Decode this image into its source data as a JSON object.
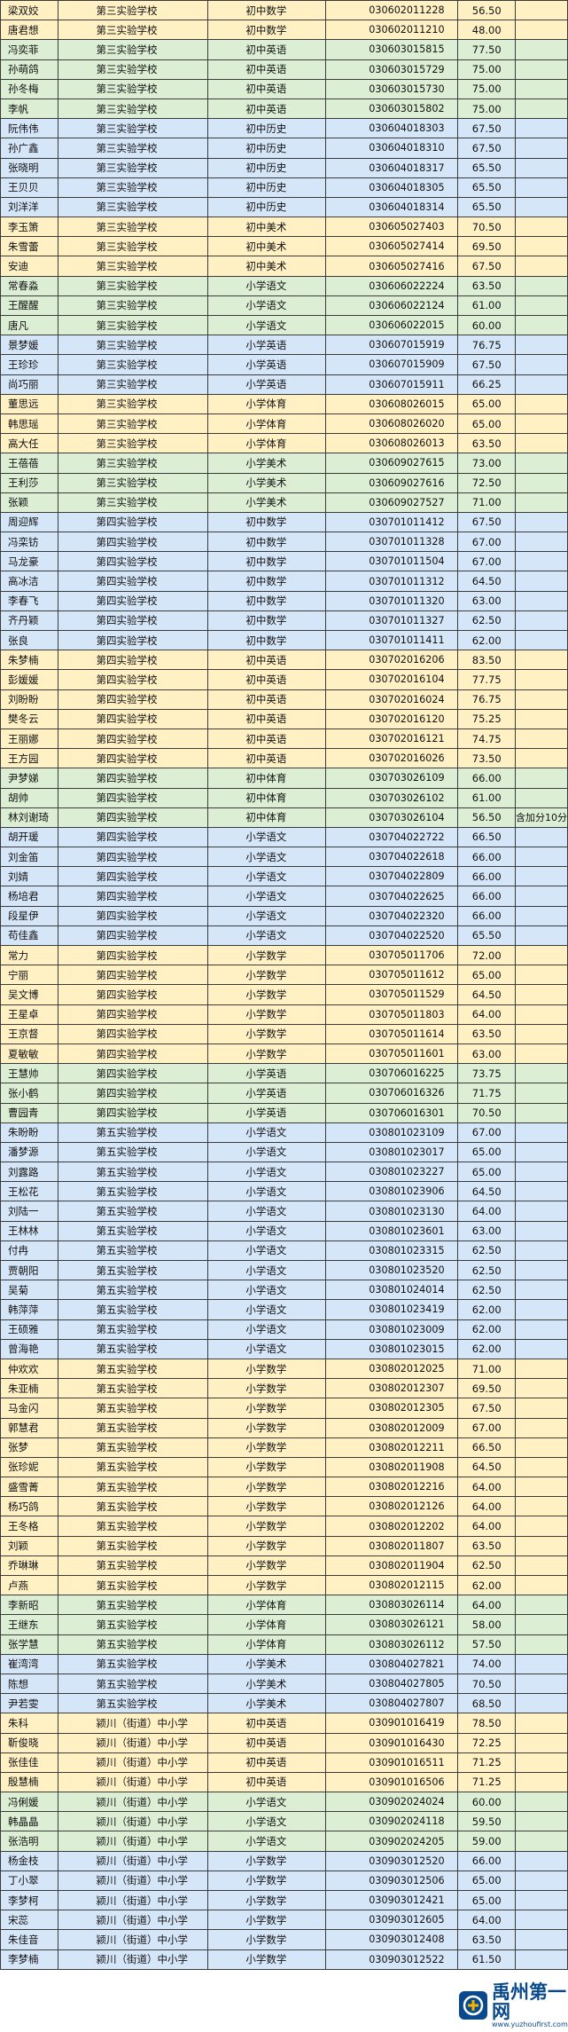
{
  "colors": {
    "yellow": "#fff1c4",
    "blue": "#d6e6f9",
    "green": "#dcefd4",
    "border": "#3b3b3b",
    "brand": "#0a4a8c"
  },
  "watermark": {
    "title": "禹州第一网",
    "url": "www.yuzhoufirst.com",
    "icon": "yuzhou-logo-icon"
  },
  "rows": [
    [
      "梁双姣",
      "第三实验学校",
      "初中数学",
      "030602011228",
      "56.50",
      "",
      "y"
    ],
    [
      "唐君想",
      "第三实验学校",
      "初中数学",
      "030602011210",
      "48.00",
      "",
      "y"
    ],
    [
      "冯奕菲",
      "第三实验学校",
      "初中英语",
      "030603015815",
      "77.50",
      "",
      "g"
    ],
    [
      "孙萌鸽",
      "第三实验学校",
      "初中英语",
      "030603015729",
      "75.00",
      "",
      "g"
    ],
    [
      "孙冬梅",
      "第三实验学校",
      "初中英语",
      "030603015730",
      "75.00",
      "",
      "g"
    ],
    [
      "李帆",
      "第三实验学校",
      "初中英语",
      "030603015802",
      "75.00",
      "",
      "g"
    ],
    [
      "阮伟伟",
      "第三实验学校",
      "初中历史",
      "030604018303",
      "67.50",
      "",
      "b"
    ],
    [
      "孙广鑫",
      "第三实验学校",
      "初中历史",
      "030604018310",
      "67.50",
      "",
      "b"
    ],
    [
      "张晓明",
      "第三实验学校",
      "初中历史",
      "030604018317",
      "65.50",
      "",
      "b"
    ],
    [
      "王贝贝",
      "第三实验学校",
      "初中历史",
      "030604018305",
      "65.50",
      "",
      "b"
    ],
    [
      "刘洋洋",
      "第三实验学校",
      "初中历史",
      "030604018314",
      "65.50",
      "",
      "b"
    ],
    [
      "李玉箫",
      "第三实验学校",
      "初中美术",
      "030605027403",
      "70.50",
      "",
      "y"
    ],
    [
      "朱雪蕾",
      "第三实验学校",
      "初中美术",
      "030605027414",
      "69.50",
      "",
      "y"
    ],
    [
      "安迪",
      "第三实验学校",
      "初中美术",
      "030605027416",
      "67.50",
      "",
      "y"
    ],
    [
      "常春淼",
      "第三实验学校",
      "小学语文",
      "030606022224",
      "63.50",
      "",
      "g"
    ],
    [
      "王醒醒",
      "第三实验学校",
      "小学语文",
      "030606022124",
      "61.00",
      "",
      "g"
    ],
    [
      "唐凡",
      "第三实验学校",
      "小学语文",
      "030606022015",
      "60.00",
      "",
      "g"
    ],
    [
      "景梦媛",
      "第三实验学校",
      "小学英语",
      "030607015919",
      "76.75",
      "",
      "b"
    ],
    [
      "王珍珍",
      "第三实验学校",
      "小学英语",
      "030607015909",
      "67.50",
      "",
      "b"
    ],
    [
      "尚巧丽",
      "第三实验学校",
      "小学英语",
      "030607015911",
      "66.25",
      "",
      "b"
    ],
    [
      "董思远",
      "第三实验学校",
      "小学体育",
      "030608026015",
      "65.00",
      "",
      "y"
    ],
    [
      "韩思瑶",
      "第三实验学校",
      "小学体育",
      "030608026020",
      "65.00",
      "",
      "y"
    ],
    [
      "高大任",
      "第三实验学校",
      "小学体育",
      "030608026013",
      "63.50",
      "",
      "y"
    ],
    [
      "王蓓蓓",
      "第三实验学校",
      "小学美术",
      "030609027615",
      "73.00",
      "",
      "g"
    ],
    [
      "王利莎",
      "第三实验学校",
      "小学美术",
      "030609027616",
      "72.50",
      "",
      "g"
    ],
    [
      "张颖",
      "第三实验学校",
      "小学美术",
      "030609027527",
      "71.00",
      "",
      "g"
    ],
    [
      "周迎辉",
      "第四实验学校",
      "初中数学",
      "030701011412",
      "67.50",
      "",
      "b"
    ],
    [
      "冯栾钫",
      "第四实验学校",
      "初中数学",
      "030701011328",
      "67.00",
      "",
      "b"
    ],
    [
      "马龙豪",
      "第四实验学校",
      "初中数学",
      "030701011504",
      "67.00",
      "",
      "b"
    ],
    [
      "高冰洁",
      "第四实验学校",
      "初中数学",
      "030701011312",
      "64.50",
      "",
      "b"
    ],
    [
      "李春飞",
      "第四实验学校",
      "初中数学",
      "030701011320",
      "63.00",
      "",
      "b"
    ],
    [
      "齐丹颖",
      "第四实验学校",
      "初中数学",
      "030701011327",
      "62.50",
      "",
      "b"
    ],
    [
      "张良",
      "第四实验学校",
      "初中数学",
      "030701011411",
      "62.00",
      "",
      "b"
    ],
    [
      "朱梦楠",
      "第四实验学校",
      "初中英语",
      "030702016206",
      "83.50",
      "",
      "y"
    ],
    [
      "彭媛媛",
      "第四实验学校",
      "初中英语",
      "030702016104",
      "77.75",
      "",
      "y"
    ],
    [
      "刘盼盼",
      "第四实验学校",
      "初中英语",
      "030702016024",
      "76.75",
      "",
      "y"
    ],
    [
      "樊冬云",
      "第四实验学校",
      "初中英语",
      "030702016120",
      "75.25",
      "",
      "y"
    ],
    [
      "王丽娜",
      "第四实验学校",
      "初中英语",
      "030702016121",
      "74.75",
      "",
      "y"
    ],
    [
      "王方园",
      "第四实验学校",
      "初中英语",
      "030702016026",
      "73.50",
      "",
      "y"
    ],
    [
      "尹梦娣",
      "第四实验学校",
      "初中体育",
      "030703026109",
      "66.00",
      "",
      "g"
    ],
    [
      "胡帅",
      "第四实验学校",
      "初中体育",
      "030703026102",
      "61.00",
      "",
      "g"
    ],
    [
      "林刘谢琦",
      "第四实验学校",
      "初中体育",
      "030703026104",
      "56.50",
      "含加分10分",
      "g"
    ],
    [
      "胡开瑗",
      "第四实验学校",
      "小学语文",
      "030704022722",
      "66.50",
      "",
      "b"
    ],
    [
      "刘金笛",
      "第四实验学校",
      "小学语文",
      "030704022618",
      "66.00",
      "",
      "b"
    ],
    [
      "刘婧",
      "第四实验学校",
      "小学语文",
      "030704022809",
      "66.00",
      "",
      "b"
    ],
    [
      "杨培君",
      "第四实验学校",
      "小学语文",
      "030704022625",
      "66.00",
      "",
      "b"
    ],
    [
      "段星伊",
      "第四实验学校",
      "小学语文",
      "030704022320",
      "66.00",
      "",
      "b"
    ],
    [
      "苟佳鑫",
      "第四实验学校",
      "小学语文",
      "030704022520",
      "65.50",
      "",
      "b"
    ],
    [
      "常力",
      "第四实验学校",
      "小学数学",
      "030705011706",
      "72.00",
      "",
      "y"
    ],
    [
      "宁丽",
      "第四实验学校",
      "小学数学",
      "030705011612",
      "65.00",
      "",
      "y"
    ],
    [
      "吴文博",
      "第四实验学校",
      "小学数学",
      "030705011529",
      "64.50",
      "",
      "y"
    ],
    [
      "王星卓",
      "第四实验学校",
      "小学数学",
      "030705011803",
      "64.00",
      "",
      "y"
    ],
    [
      "王京督",
      "第四实验学校",
      "小学数学",
      "030705011614",
      "63.50",
      "",
      "y"
    ],
    [
      "夏敏敏",
      "第四实验学校",
      "小学数学",
      "030705011601",
      "63.00",
      "",
      "y"
    ],
    [
      "王慧帅",
      "第四实验学校",
      "小学英语",
      "030706016225",
      "73.75",
      "",
      "g"
    ],
    [
      "张小鹤",
      "第四实验学校",
      "小学英语",
      "030706016326",
      "71.75",
      "",
      "g"
    ],
    [
      "曹园青",
      "第四实验学校",
      "小学英语",
      "030706016301",
      "70.50",
      "",
      "g"
    ],
    [
      "朱盼盼",
      "第五实验学校",
      "小学语文",
      "030801023109",
      "67.00",
      "",
      "b"
    ],
    [
      "潘梦源",
      "第五实验学校",
      "小学语文",
      "030801023017",
      "65.00",
      "",
      "b"
    ],
    [
      "刘露路",
      "第五实验学校",
      "小学语文",
      "030801023227",
      "65.00",
      "",
      "b"
    ],
    [
      "王松花",
      "第五实验学校",
      "小学语文",
      "030801023906",
      "64.50",
      "",
      "b"
    ],
    [
      "刘陆一",
      "第五实验学校",
      "小学语文",
      "030801023130",
      "64.00",
      "",
      "b"
    ],
    [
      "王林林",
      "第五实验学校",
      "小学语文",
      "030801023601",
      "63.00",
      "",
      "b"
    ],
    [
      "付冉",
      "第五实验学校",
      "小学语文",
      "030801023315",
      "62.50",
      "",
      "b"
    ],
    [
      "贾朝阳",
      "第五实验学校",
      "小学语文",
      "030801023520",
      "62.50",
      "",
      "b"
    ],
    [
      "吴菊",
      "第五实验学校",
      "小学语文",
      "030801024014",
      "62.50",
      "",
      "b"
    ],
    [
      "韩萍萍",
      "第五实验学校",
      "小学语文",
      "030801023419",
      "62.00",
      "",
      "b"
    ],
    [
      "王硕雅",
      "第五实验学校",
      "小学语文",
      "030801023009",
      "62.00",
      "",
      "b"
    ],
    [
      "曾海艳",
      "第五实验学校",
      "小学语文",
      "030801023015",
      "62.00",
      "",
      "b"
    ],
    [
      "仲欢欢",
      "第五实验学校",
      "小学数学",
      "030802012025",
      "71.00",
      "",
      "y"
    ],
    [
      "朱亚楠",
      "第五实验学校",
      "小学数学",
      "030802012307",
      "69.50",
      "",
      "y"
    ],
    [
      "马金闪",
      "第五实验学校",
      "小学数学",
      "030802012305",
      "67.50",
      "",
      "y"
    ],
    [
      "郭慧君",
      "第五实验学校",
      "小学数学",
      "030802012009",
      "67.00",
      "",
      "y"
    ],
    [
      "张梦",
      "第五实验学校",
      "小学数学",
      "030802012211",
      "66.50",
      "",
      "y"
    ],
    [
      "张珍妮",
      "第五实验学校",
      "小学数学",
      "030802011908",
      "64.50",
      "",
      "y"
    ],
    [
      "盛雪菁",
      "第五实验学校",
      "小学数学",
      "030802012216",
      "64.00",
      "",
      "y"
    ],
    [
      "杨巧鸽",
      "第五实验学校",
      "小学数学",
      "030802012126",
      "64.00",
      "",
      "y"
    ],
    [
      "王冬格",
      "第五实验学校",
      "小学数学",
      "030802012202",
      "64.00",
      "",
      "y"
    ],
    [
      "刘颖",
      "第五实验学校",
      "小学数学",
      "030802011807",
      "63.50",
      "",
      "y"
    ],
    [
      "乔琳琳",
      "第五实验学校",
      "小学数学",
      "030802011904",
      "62.50",
      "",
      "y"
    ],
    [
      "卢燕",
      "第五实验学校",
      "小学数学",
      "030802012115",
      "62.00",
      "",
      "y"
    ],
    [
      "李新昭",
      "第五实验学校",
      "小学体育",
      "030803026114",
      "64.00",
      "",
      "g"
    ],
    [
      "王继东",
      "第五实验学校",
      "小学体育",
      "030803026121",
      "58.00",
      "",
      "g"
    ],
    [
      "张学慧",
      "第五实验学校",
      "小学体育",
      "030803026112",
      "57.50",
      "",
      "g"
    ],
    [
      "崔湾湾",
      "第五实验学校",
      "小学美术",
      "030804027821",
      "74.00",
      "",
      "b"
    ],
    [
      "陈想",
      "第五实验学校",
      "小学美术",
      "030804027805",
      "70.50",
      "",
      "b"
    ],
    [
      "尹若雯",
      "第五实验学校",
      "小学美术",
      "030804027807",
      "68.50",
      "",
      "b"
    ],
    [
      "朱科",
      "颍川（街道）中小学",
      "初中英语",
      "030901016419",
      "78.50",
      "",
      "y"
    ],
    [
      "靳俊晓",
      "颍川（街道）中小学",
      "初中英语",
      "030901016430",
      "72.25",
      "",
      "y"
    ],
    [
      "张佳佳",
      "颍川（街道）中小学",
      "初中英语",
      "030901016511",
      "71.25",
      "",
      "y"
    ],
    [
      "殷慧楠",
      "颍川（街道）中小学",
      "初中英语",
      "030901016506",
      "71.25",
      "",
      "y"
    ],
    [
      "冯俐媛",
      "颍川（街道）中小学",
      "小学语文",
      "030902024024",
      "60.00",
      "",
      "g"
    ],
    [
      "韩晶晶",
      "颍川（街道）中小学",
      "小学语文",
      "030902024118",
      "59.50",
      "",
      "g"
    ],
    [
      "张浩明",
      "颍川（街道）中小学",
      "小学语文",
      "030902024205",
      "59.00",
      "",
      "g"
    ],
    [
      "杨金枝",
      "颍川（街道）中小学",
      "小学数学",
      "030903012520",
      "66.00",
      "",
      "b"
    ],
    [
      "丁小翠",
      "颍川（街道）中小学",
      "小学数学",
      "030903012506",
      "65.00",
      "",
      "b"
    ],
    [
      "李梦柯",
      "颍川（街道）中小学",
      "小学数学",
      "030903012421",
      "65.00",
      "",
      "b"
    ],
    [
      "宋蕊",
      "颍川（街道）中小学",
      "小学数学",
      "030903012605",
      "64.00",
      "",
      "b"
    ],
    [
      "朱佳音",
      "颍川（街道）中小学",
      "小学数学",
      "030903012408",
      "63.50",
      "",
      "b"
    ],
    [
      "李梦楠",
      "颍川（街道）中小学",
      "小学数学",
      "030903012522",
      "61.50",
      "",
      "b"
    ]
  ]
}
